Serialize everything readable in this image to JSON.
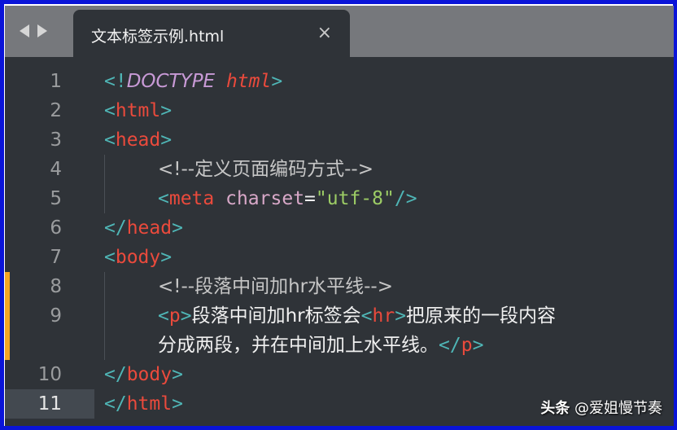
{
  "tabbar": {
    "nav_back_icon": "triangle-left",
    "nav_forward_icon": "triangle-right",
    "tab_title": "文本标签示例.html",
    "close_glyph": "×"
  },
  "editor": {
    "active_line": 11,
    "modified_lines": [
      8,
      9
    ],
    "lines": [
      {
        "num": "1",
        "tokens": [
          {
            "t": "<",
            "c": "punct"
          },
          {
            "t": "!",
            "c": "punct"
          },
          {
            "t": "DOCTYPE",
            "c": "doctype"
          },
          {
            "t": " "
          },
          {
            "t": "html",
            "c": "doctype-kw"
          },
          {
            "t": ">",
            "c": "punct"
          }
        ]
      },
      {
        "num": "2",
        "tokens": [
          {
            "t": "<",
            "c": "punct"
          },
          {
            "t": "html",
            "c": "tag"
          },
          {
            "t": ">",
            "c": "punct"
          }
        ]
      },
      {
        "num": "3",
        "tokens": [
          {
            "t": "<",
            "c": "punct"
          },
          {
            "t": "head",
            "c": "tag"
          },
          {
            "t": ">",
            "c": "punct"
          }
        ]
      },
      {
        "num": "4",
        "indent": true,
        "tokens": [
          {
            "t": "<!--定义页面编码方式-->",
            "c": "comment"
          }
        ]
      },
      {
        "num": "5",
        "indent": true,
        "tokens": [
          {
            "t": "<",
            "c": "punct"
          },
          {
            "t": "meta",
            "c": "tag"
          },
          {
            "t": " "
          },
          {
            "t": "charset",
            "c": "attr"
          },
          {
            "t": "=",
            "c": "text"
          },
          {
            "t": "\"utf-8\"",
            "c": "str"
          },
          {
            "t": "/>",
            "c": "punct"
          }
        ]
      },
      {
        "num": "6",
        "tokens": [
          {
            "t": "</",
            "c": "punct"
          },
          {
            "t": "head",
            "c": "tag"
          },
          {
            "t": ">",
            "c": "punct"
          }
        ]
      },
      {
        "num": "7",
        "tokens": [
          {
            "t": "<",
            "c": "punct"
          },
          {
            "t": "body",
            "c": "tag"
          },
          {
            "t": ">",
            "c": "punct"
          }
        ]
      },
      {
        "num": "8",
        "indent": true,
        "tokens": [
          {
            "t": "<!--段落中间加hr水平线-->",
            "c": "comment"
          }
        ]
      },
      {
        "num": "9",
        "indent": true,
        "tokens": [
          {
            "t": "<",
            "c": "punct"
          },
          {
            "t": "p",
            "c": "tag"
          },
          {
            "t": ">",
            "c": "punct"
          },
          {
            "t": "段落中间加hr标签会",
            "c": "text"
          },
          {
            "t": "<",
            "c": "punct"
          },
          {
            "t": "hr",
            "c": "tag"
          },
          {
            "t": ">",
            "c": "punct"
          },
          {
            "t": "把原来的一段内容",
            "c": "text"
          }
        ]
      },
      {
        "num": "",
        "indent": true,
        "tokens": [
          {
            "t": "分成两段，并在中间加上水平线。",
            "c": "text"
          },
          {
            "t": "</",
            "c": "punct"
          },
          {
            "t": "p",
            "c": "tag"
          },
          {
            "t": ">",
            "c": "punct"
          }
        ]
      },
      {
        "num": "10",
        "tokens": [
          {
            "t": "</",
            "c": "punct"
          },
          {
            "t": "body",
            "c": "tag"
          },
          {
            "t": ">",
            "c": "punct"
          }
        ]
      },
      {
        "num": "11",
        "tokens": [
          {
            "t": "</",
            "c": "punct"
          },
          {
            "t": "html",
            "c": "tag"
          },
          {
            "t": ">",
            "c": "punct"
          }
        ]
      }
    ]
  },
  "watermark": {
    "brand": "头条",
    "handle": "@爱姐慢节奏"
  },
  "colors": {
    "background": "#2f3338",
    "tabbar": "#76787c",
    "tag": "#ea4a3c",
    "punctuation": "#4fb6b6",
    "string": "#9ccc65",
    "modified_marker": "#f5a623"
  }
}
